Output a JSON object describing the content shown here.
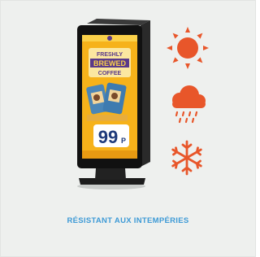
{
  "feature": {
    "caption": "RÉSISTANT AUX INTEMPÉRIES",
    "caption_color": "#3d9ad6",
    "accent_color": "#e8562a"
  },
  "kiosk_screen": {
    "headline_top": "FRESHLY",
    "headline_mid": "BREWED",
    "headline_bottom": "COFFEE",
    "price": "99",
    "price_suffix": "P"
  },
  "icons": [
    "sun-icon",
    "rain-cloud-icon",
    "snowflake-icon"
  ]
}
